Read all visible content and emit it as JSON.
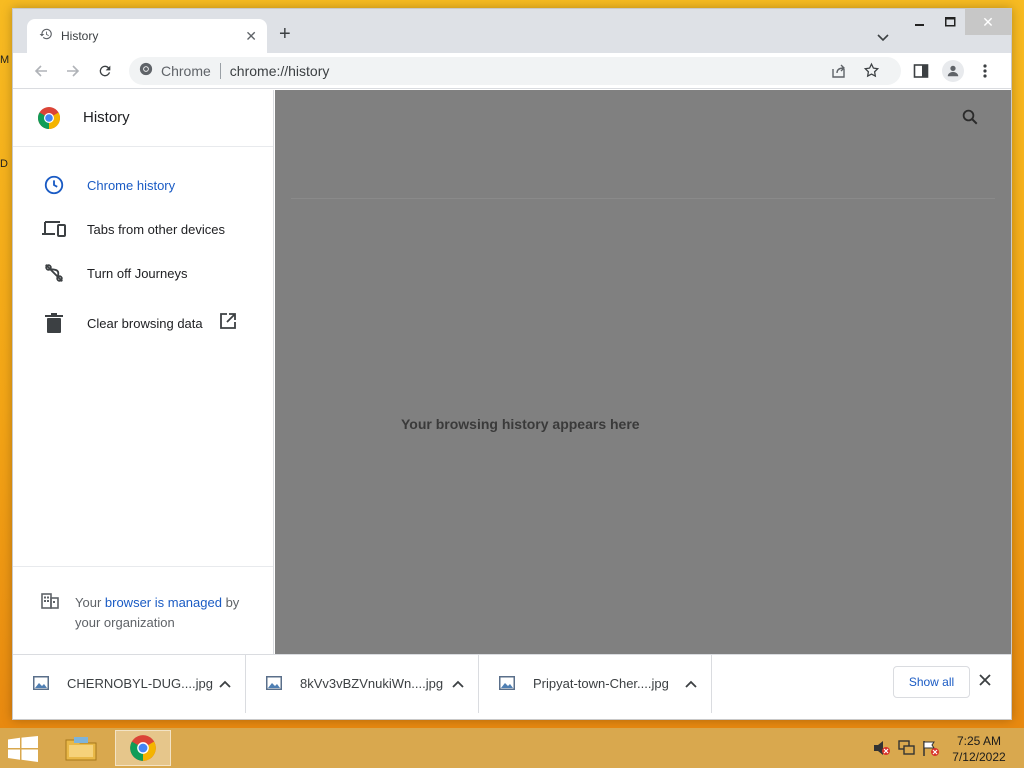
{
  "browser": {
    "tab_title": "History",
    "omnibox_site": "Chrome",
    "omnibox_url": "chrome://history"
  },
  "sidebar": {
    "title": "History",
    "items": [
      {
        "label": "Chrome history",
        "icon": "clock-icon",
        "active": true
      },
      {
        "label": "Tabs from other devices",
        "icon": "devices-icon"
      },
      {
        "label": "Turn off Journeys",
        "icon": "journeys-off-icon"
      },
      {
        "label": "Clear browsing data",
        "icon": "trash-icon"
      }
    ],
    "managed": {
      "prefix": "Your ",
      "link": "browser is managed",
      "suffix": " by your organization"
    }
  },
  "main": {
    "empty_message": "Your browsing history appears here"
  },
  "downloads": {
    "items": [
      {
        "name": "CHERNOBYL-DUG....jpg"
      },
      {
        "name": "8kVv3vBZVnukiWn....jpg"
      },
      {
        "name": "Pripyat-town-Cher....jpg"
      }
    ],
    "show_all": "Show all"
  },
  "taskbar": {
    "time": "7:25 AM",
    "date": "7/12/2022"
  },
  "colors": {
    "accent": "#1a5bc4",
    "overlay": "#808080",
    "desktop": "#f3a516"
  }
}
